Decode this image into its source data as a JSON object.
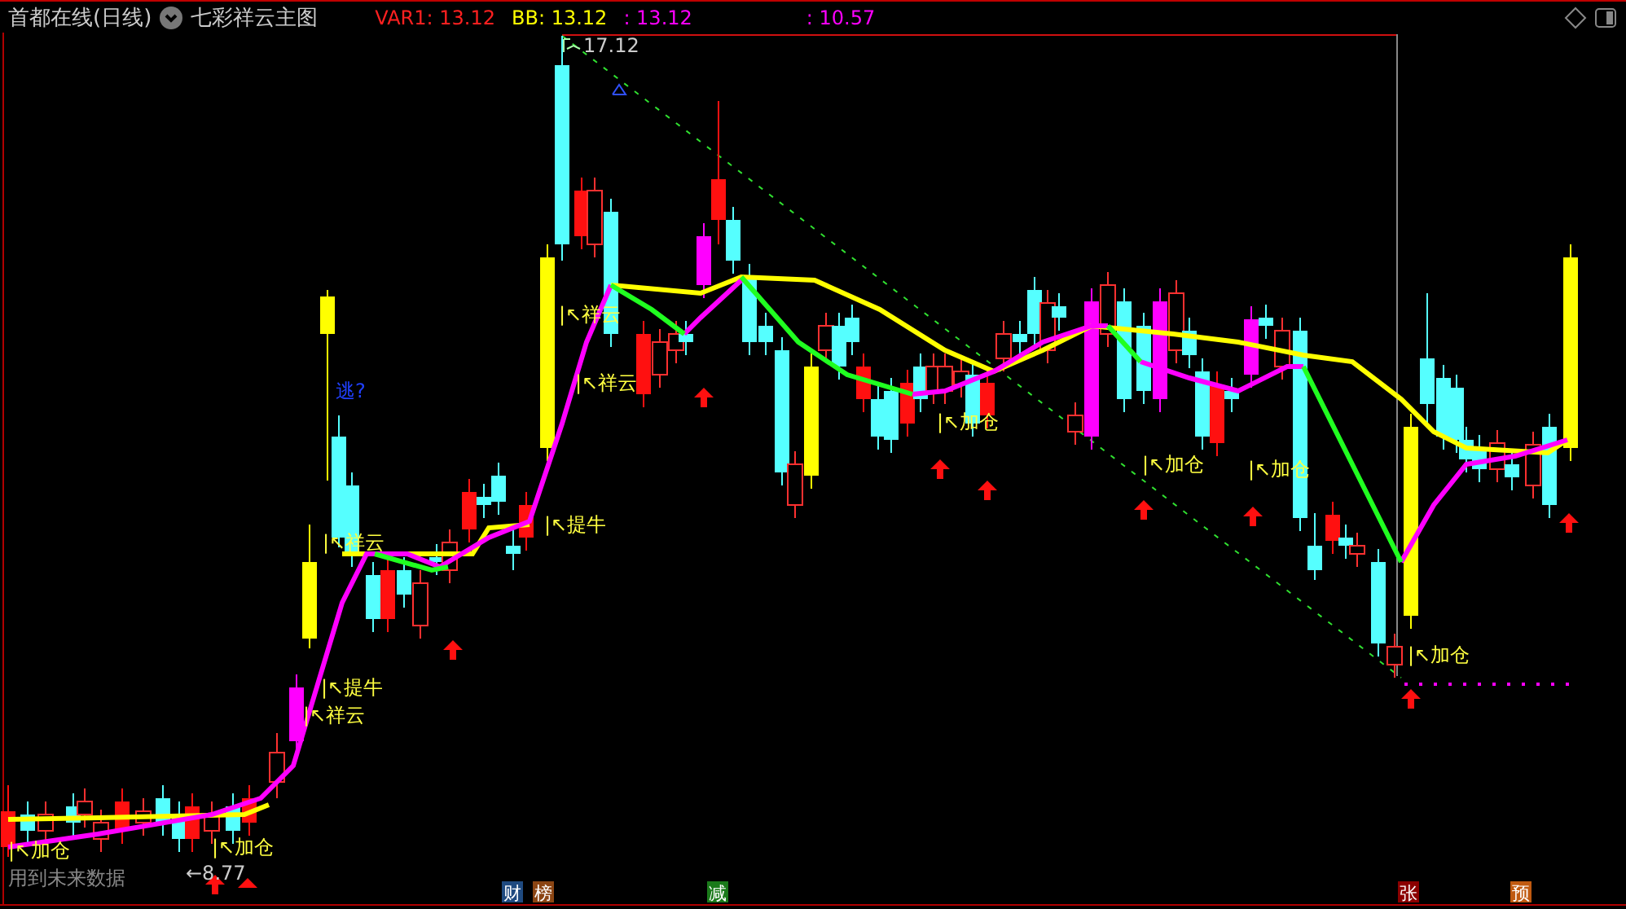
{
  "header": {
    "title": "首都在线(日线)",
    "formula": "七彩祥云主图",
    "indicators": [
      {
        "text": "VAR1: 13.12",
        "color": "#ff2020"
      },
      {
        "text": "BB: 13.12",
        "color": "#ffff00"
      },
      {
        "text": ": 13.12",
        "color": "#ff00ff"
      },
      {
        "text": ": 10.57",
        "color": "#ff00ff"
      }
    ]
  },
  "chart": {
    "high_label": "17.12",
    "low_label": "←8.77",
    "warning": "逃?",
    "signals": [
      {
        "text": "|↖祥云"
      },
      {
        "text": "|↖祥云"
      },
      {
        "text": "|↖加仓"
      },
      {
        "text": "|↖加仓"
      },
      {
        "text": "|↖加仓"
      },
      {
        "text": "|↖提牛"
      },
      {
        "text": "|↖祥云"
      },
      {
        "text": "|↖加仓"
      },
      {
        "text": "|↖提牛"
      },
      {
        "text": "|↖祥云"
      },
      {
        "text": "|↖加仓"
      },
      {
        "text": "|↖加仓"
      }
    ],
    "note": "用到未来数据"
  },
  "badges": [
    {
      "text": "财",
      "color": "#1f4a80"
    },
    {
      "text": "榜",
      "color": "#8b4513"
    },
    {
      "text": "减",
      "color": "#1a7a1a"
    },
    {
      "text": "张",
      "color": "#8b0000"
    },
    {
      "text": "预",
      "color": "#c05a10"
    }
  ]
}
